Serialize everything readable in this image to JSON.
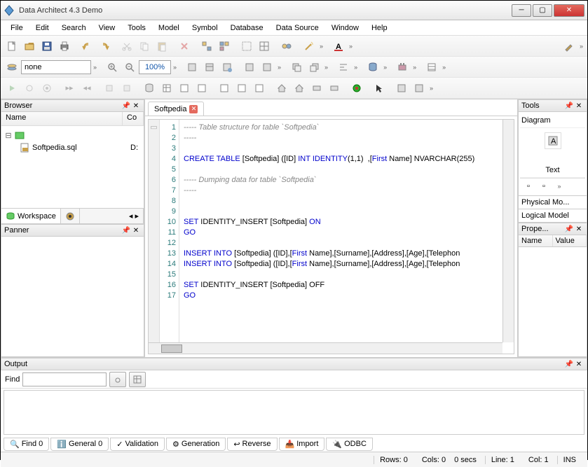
{
  "title": "Data Architect 4.3 Demo",
  "menu": [
    "File",
    "Edit",
    "Search",
    "View",
    "Tools",
    "Model",
    "Symbol",
    "Database",
    "Data Source",
    "Window",
    "Help"
  ],
  "toolbar2": {
    "select_value": "none",
    "zoom": "100%"
  },
  "browser": {
    "title": "Browser",
    "cols": [
      "Name",
      "Co"
    ],
    "tree_root": "Softpedia.sql",
    "tree_root_meta": "D:",
    "tabs": [
      "Workspace"
    ]
  },
  "panner": {
    "title": "Panner"
  },
  "doc_tab": "Softpedia",
  "code_lines": [
    {
      "n": 1,
      "t": "----- Table structure for table `Softpedia`",
      "cls": "cm"
    },
    {
      "n": 2,
      "t": "-----",
      "cls": "cm"
    },
    {
      "n": 3,
      "t": "",
      "cls": ""
    },
    {
      "n": 4,
      "html": "<span class='kw'>CREATE TABLE</span> [Softpedia] ([ID] <span class='kw'>INT IDENTITY</span>(1,1)  ,[<span class='kw'>First</span> Name] NVARCHAR(255)"
    },
    {
      "n": 5,
      "t": "",
      "cls": ""
    },
    {
      "n": 6,
      "t": "----- Dumping data for table `Softpedia`",
      "cls": "cm"
    },
    {
      "n": 7,
      "t": "-----",
      "cls": "cm"
    },
    {
      "n": 8,
      "t": "",
      "cls": ""
    },
    {
      "n": 9,
      "t": "",
      "cls": ""
    },
    {
      "n": 10,
      "html": "<span class='kw'>SET</span> IDENTITY_INSERT [Softpedia] <span class='kw'>ON</span>"
    },
    {
      "n": 11,
      "html": "<span class='kw'>GO</span>"
    },
    {
      "n": 12,
      "t": "",
      "cls": ""
    },
    {
      "n": 13,
      "html": "<span class='kw'>INSERT INTO</span> [Softpedia] ([ID],[<span class='kw'>First</span> Name],[Surname],[Address],[Age],[Telephon"
    },
    {
      "n": 14,
      "html": "<span class='kw'>INSERT INTO</span> [Softpedia] ([ID],[<span class='kw'>First</span> Name],[Surname],[Address],[Age],[Telephon"
    },
    {
      "n": 15,
      "t": "",
      "cls": ""
    },
    {
      "n": 16,
      "html": "<span class='kw'>SET</span> IDENTITY_INSERT [Softpedia] OFF"
    },
    {
      "n": 17,
      "html": "<span class='kw'>GO</span>"
    }
  ],
  "tools": {
    "title": "Tools",
    "categories": [
      "Diagram",
      "Text"
    ],
    "lists": [
      "Physical Mo...",
      "Logical Model"
    ],
    "props_title": "Prope...",
    "prop_cols": [
      "Name",
      "Value"
    ]
  },
  "output": {
    "title": "Output",
    "find_label": "Find",
    "tabs": [
      "Find 0",
      "General 0",
      "Validation",
      "Generation",
      "Reverse",
      "Import",
      "ODBC"
    ]
  },
  "status": {
    "rows": "Rows: 0",
    "cols": "Cols: 0",
    "secs": "0 secs",
    "line": "Line: 1",
    "col": "Col: 1",
    "ins": "INS"
  }
}
